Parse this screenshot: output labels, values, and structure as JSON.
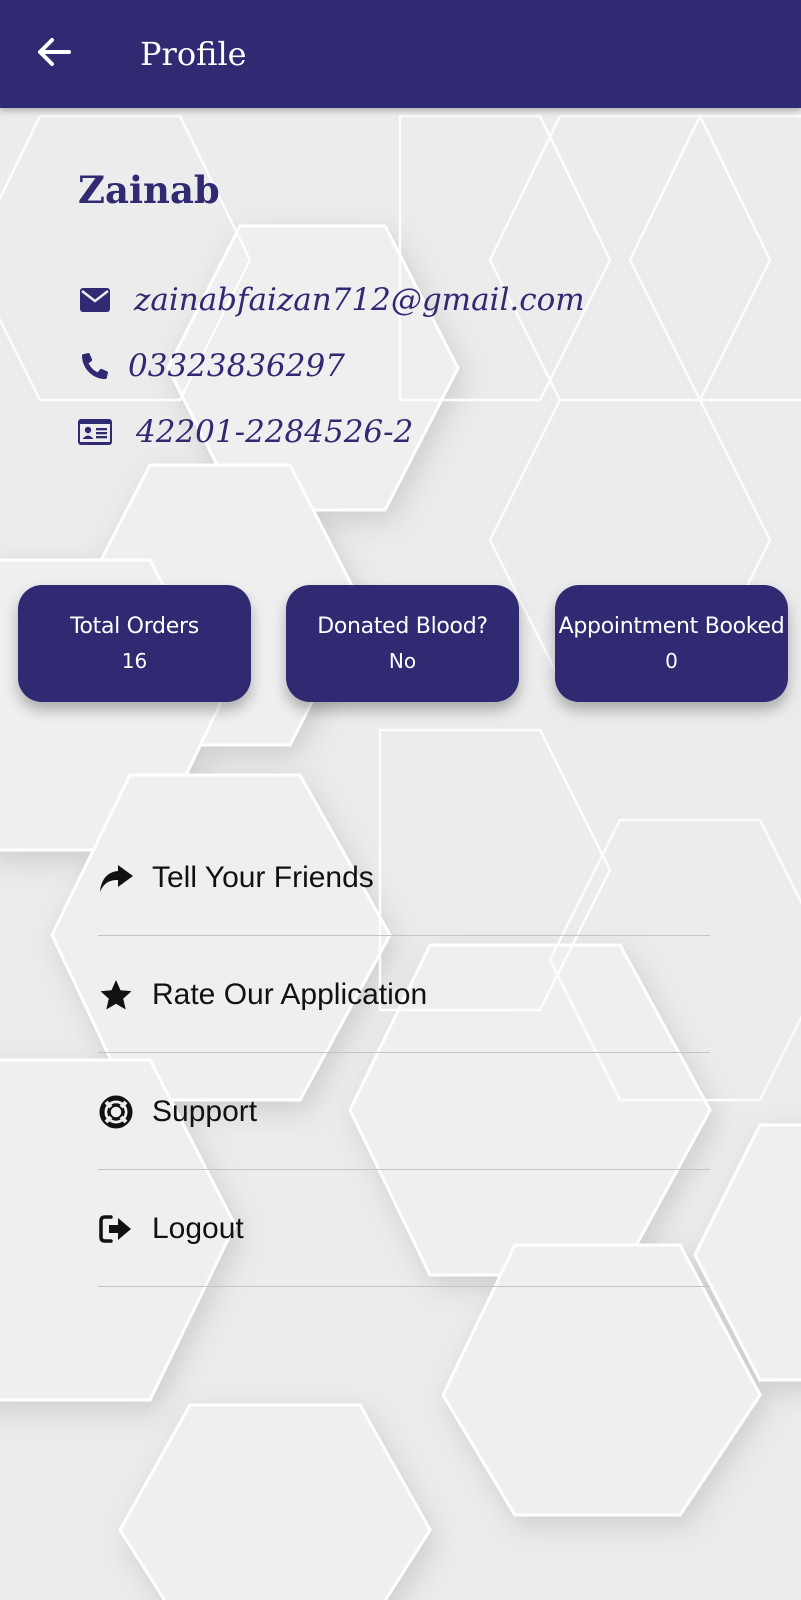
{
  "colors": {
    "primary": "#302a72",
    "background": "#ececed",
    "appbar_text": "#ffffff",
    "menu_text": "#111111",
    "divider": "#c4c4c6"
  },
  "header": {
    "back_icon": "arrow-left-icon",
    "title": "Profile"
  },
  "profile": {
    "name": "Zainab",
    "email": {
      "icon": "envelope-icon",
      "value": "zainabfaizan712@gmail.com"
    },
    "phone": {
      "icon": "phone-icon",
      "value": "03323836297"
    },
    "cnic": {
      "icon": "id-card-icon",
      "value": "42201-2284526-2"
    }
  },
  "stats": [
    {
      "label": "Total Orders",
      "value": "16"
    },
    {
      "label": "Donated Blood?",
      "value": "No"
    },
    {
      "label": "Appointment Booked",
      "value": "0"
    }
  ],
  "menu": [
    {
      "icon": "share-icon",
      "label": "Tell Your Friends"
    },
    {
      "icon": "star-icon",
      "label": "Rate Our Application"
    },
    {
      "icon": "life-ring-icon",
      "label": "Support"
    },
    {
      "icon": "sign-out-icon",
      "label": "Logout"
    }
  ]
}
